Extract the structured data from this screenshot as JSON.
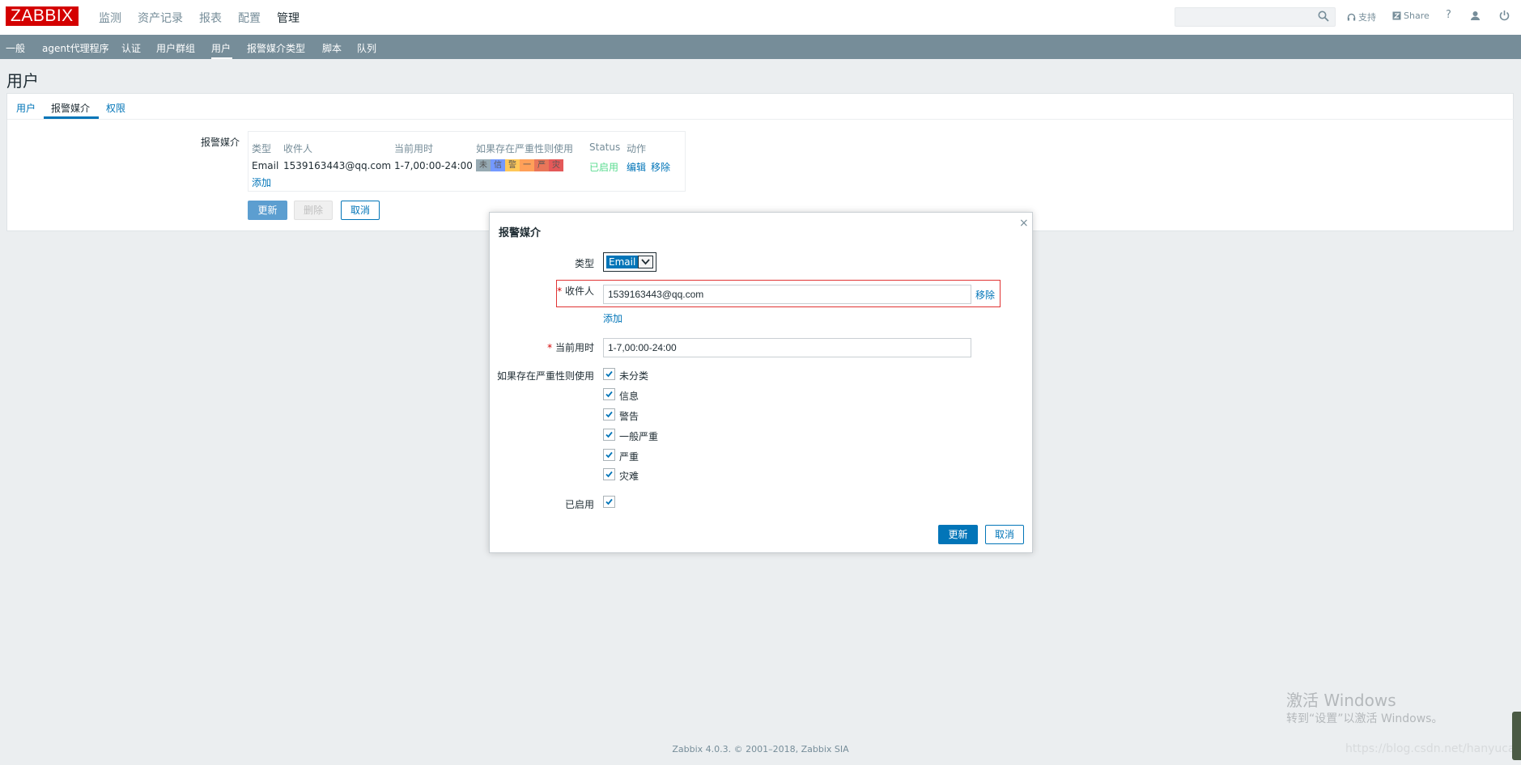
{
  "header": {
    "logo": "ZABBIX",
    "nav": [
      "监测",
      "资产记录",
      "报表",
      "配置",
      "管理"
    ],
    "active_nav": "管理",
    "support_label": "支持",
    "share_label": "Share",
    "help_label": "?"
  },
  "subnav": {
    "items": [
      "一般",
      "agent代理程序",
      "认证",
      "用户群组",
      "用户",
      "报警媒介类型",
      "脚本",
      "队列"
    ],
    "active": "用户"
  },
  "page": {
    "title": "用户",
    "tabs": [
      "用户",
      "报警媒介",
      "权限"
    ],
    "active_tab": "报警媒介",
    "media_label": "报警媒介",
    "table": {
      "headers": [
        "类型",
        "收件人",
        "当前用时",
        "如果存在严重性则使用",
        "Status",
        "动作"
      ],
      "row": {
        "type": "Email",
        "recipient": "1539163443@qq.com",
        "when_active": "1-7,00:00-24:00",
        "severities": [
          "未",
          "信",
          "警",
          "一",
          "严",
          "灾"
        ],
        "status": "已启用",
        "edit": "编辑",
        "remove": "移除"
      },
      "add": "添加"
    },
    "buttons": {
      "update": "更新",
      "delete": "删除",
      "cancel": "取消"
    }
  },
  "dialog": {
    "title": "报警媒介",
    "close": "×",
    "type_label": "类型",
    "type_value": "Email",
    "sendto_label": "收件人",
    "sendto_value": "1539163443@qq.com",
    "sendto_remove": "移除",
    "sendto_add": "添加",
    "period_label": "当前用时",
    "period_value": "1-7,00:00-24:00",
    "severity_label": "如果存在严重性则使用",
    "severities": [
      "未分类",
      "信息",
      "警告",
      "一般严重",
      "严重",
      "灾难"
    ],
    "enabled_label": "已启用",
    "update": "更新",
    "cancel": "取消"
  },
  "footer": "Zabbix 4.0.3. © 2001–2018, Zabbix SIA",
  "watermark": {
    "line1": "激活 Windows",
    "line2": "转到“设置”以激活 Windows。",
    "url": "https://blog.csdn.net/hanyuca"
  },
  "colors": {
    "accent": "#0275b8",
    "subnav": "#768d99",
    "logo": "#d40000",
    "enabled": "#59db8f",
    "severity": [
      "#97aab3",
      "#7499ff",
      "#ffc859",
      "#ffa059",
      "#e97659",
      "#e45959"
    ]
  }
}
